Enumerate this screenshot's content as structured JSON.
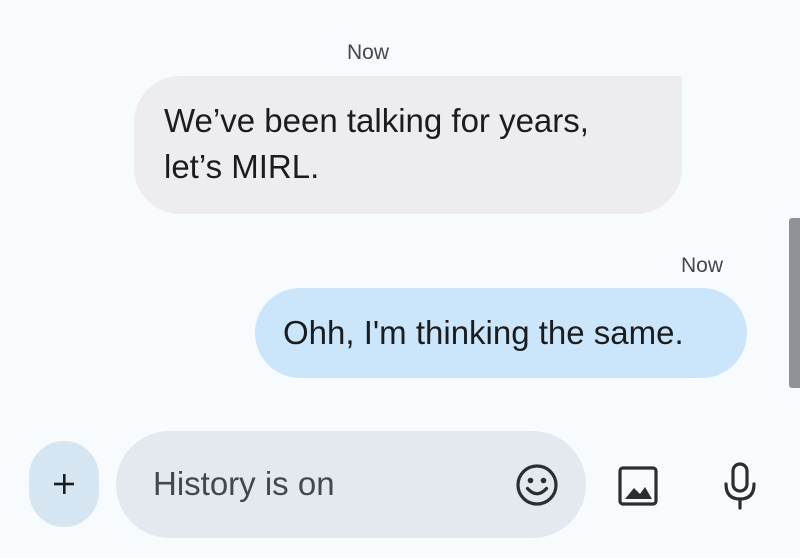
{
  "messages": [
    {
      "direction": "received",
      "timestamp": "Now",
      "line1": "We’ve been talking for years,",
      "line2": "let’s MIRL."
    },
    {
      "direction": "sent",
      "timestamp": "Now",
      "text": "Ohh, I'm thinking the same."
    }
  ],
  "composer": {
    "placeholder": "History is on",
    "add_label": "+"
  },
  "icons": {
    "add": "plus-icon",
    "emoji": "emoji-icon",
    "image": "image-icon",
    "mic": "microphone-icon"
  },
  "colors": {
    "background": "#f7fbfd",
    "received_bubble": "#ededf0",
    "sent_bubble": "#cbe6fb",
    "compose_field": "#e3e9ef",
    "add_button": "#d5e6f2",
    "text": "#1b1c1e"
  }
}
